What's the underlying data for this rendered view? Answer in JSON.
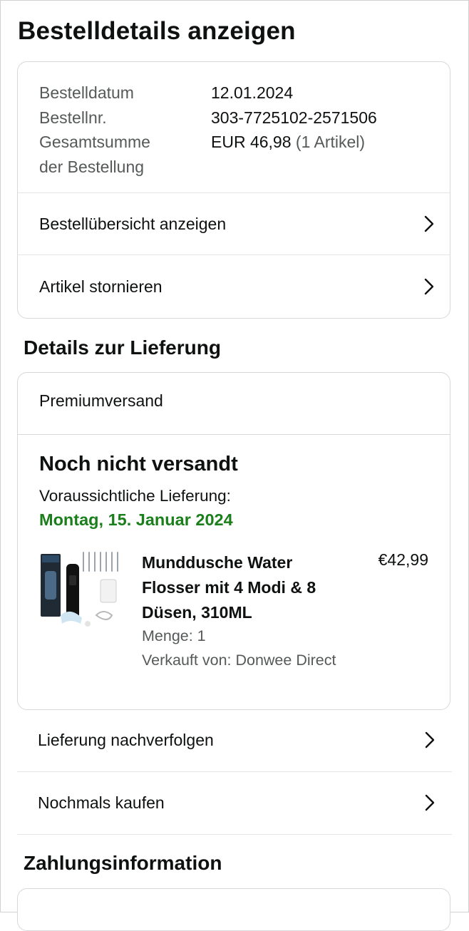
{
  "page": {
    "title": "Bestelldetails anzeigen"
  },
  "order_summary": {
    "rows": [
      {
        "label": "Bestelldatum",
        "value": "12.01.2024"
      },
      {
        "label": "Bestellnr.",
        "value": "303-7725102-2571506"
      }
    ],
    "total_label_line1": "Gesamtsumme",
    "total_label_line2": "der Bestellung",
    "total_value": "EUR 46,98",
    "total_items": "(1 Artikel)",
    "links": [
      {
        "label": "Bestellübersicht anzeigen",
        "icon": "chevron-right-icon"
      },
      {
        "label": "Artikel stornieren",
        "icon": "chevron-right-icon"
      }
    ]
  },
  "delivery": {
    "section_title": "Details zur Lieferung",
    "shipping_method": "Premiumversand",
    "status": "Noch nicht versandt",
    "expected_label": "Voraussichtliche Lieferung:",
    "expected_date": "Montag, 15. Januar 2024",
    "date_color": "#1a7f1a",
    "item": {
      "title": "Munddusche Water Flosser mit 4 Modi & 8 Düsen, 310ML",
      "price": "€42,99",
      "quantity": "Menge: 1",
      "seller": "Verkauft von: Donwee Direct"
    },
    "actions": [
      {
        "label": "Lieferung nachverfolgen",
        "icon": "chevron-right-icon"
      },
      {
        "label": "Nochmals kaufen",
        "icon": "chevron-right-icon"
      }
    ]
  },
  "payment": {
    "section_title": "Zahlungsinformation"
  }
}
